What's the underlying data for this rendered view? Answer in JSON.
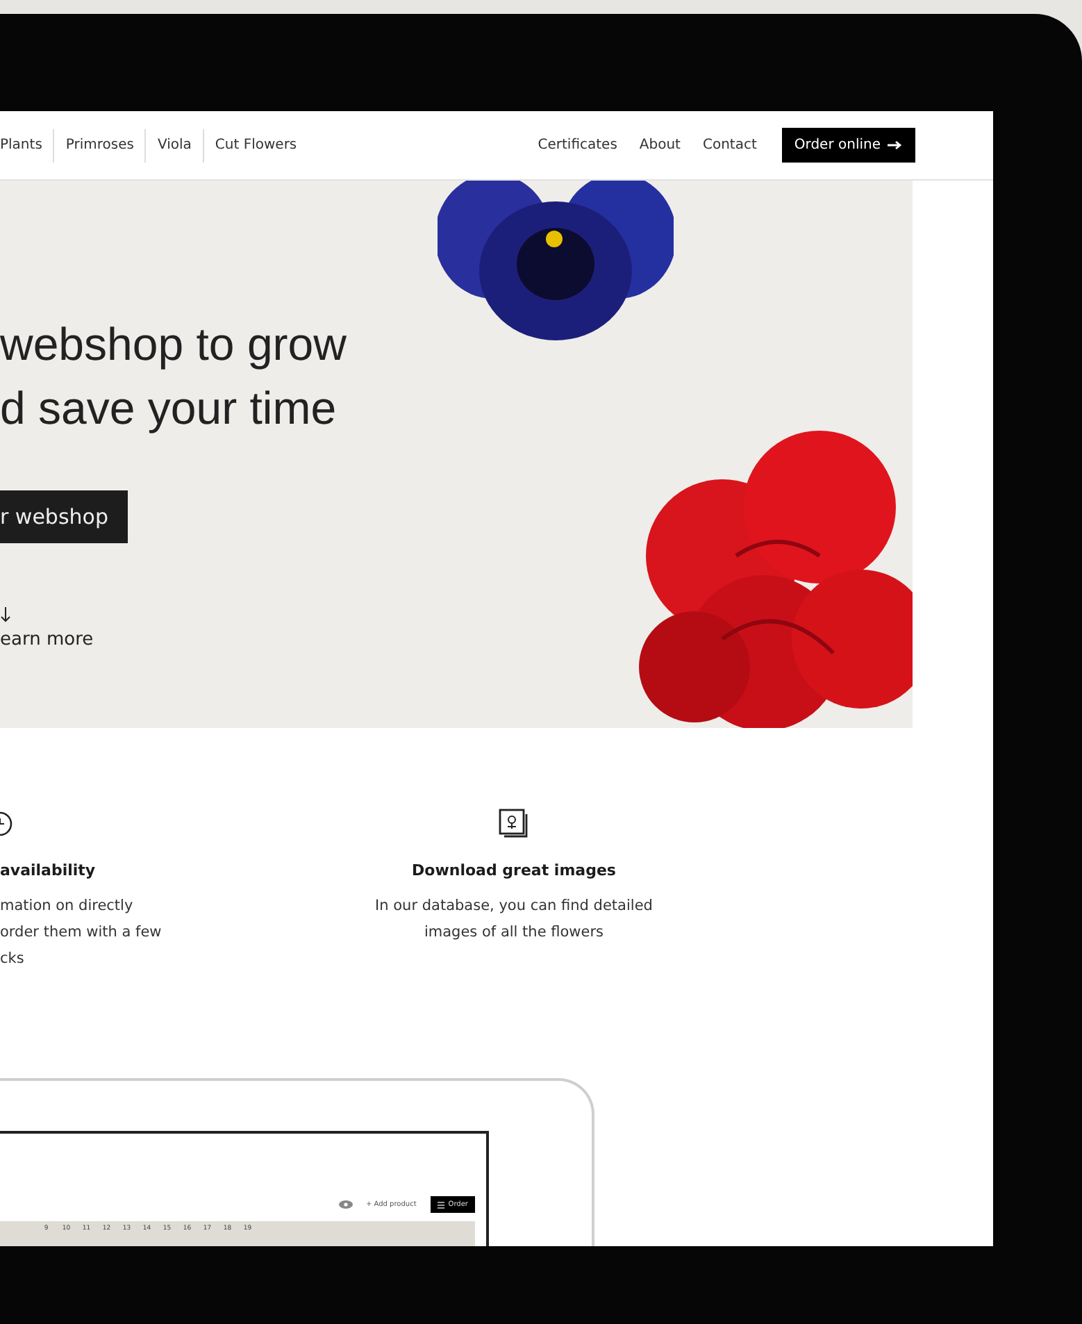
{
  "nav": {
    "links": [
      {
        "label": "Plants"
      },
      {
        "label": "Primroses"
      },
      {
        "label": "Viola"
      },
      {
        "label": "Cut Flowers"
      }
    ],
    "right_links": [
      "Certificates",
      "About",
      "Contact"
    ],
    "cta": "Order online"
  },
  "hero": {
    "headline": [
      "webshop to grow",
      "d save your time"
    ],
    "button": "r webshop",
    "learn_more": "earn more"
  },
  "features": [
    {
      "kind": "clock",
      "title": "availability",
      "lines": [
        "mation on directly",
        "order them with a few",
        "cks"
      ]
    },
    {
      "kind": "image",
      "title": "Download great images",
      "lines": [
        "In our database, you can find detailed",
        "images of all the flowers"
      ]
    }
  ],
  "tablet": {
    "add_product": "+ Add product",
    "order": "Order",
    "days": [
      "9",
      "10",
      "11",
      "12",
      "13",
      "14",
      "15",
      "16",
      "17",
      "18",
      "19"
    ]
  }
}
